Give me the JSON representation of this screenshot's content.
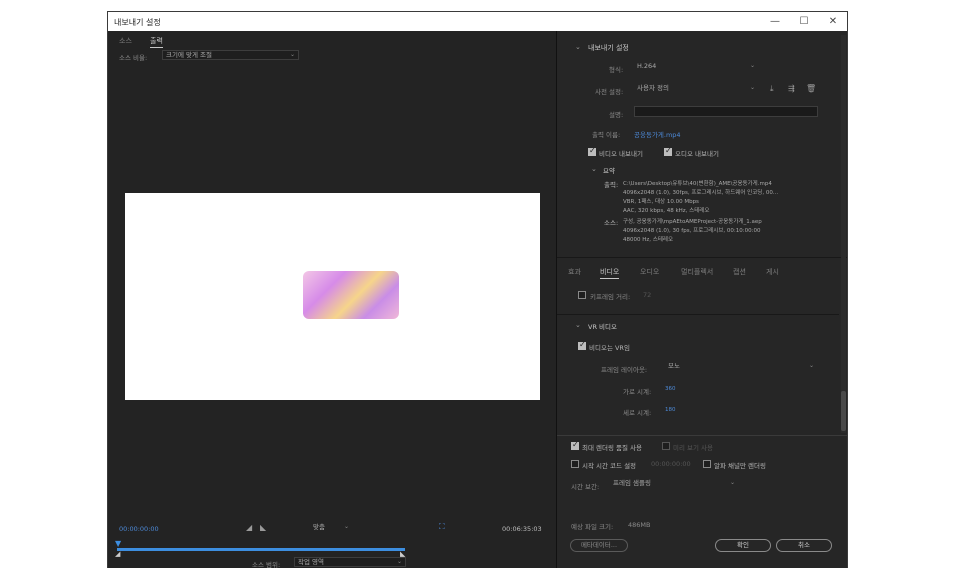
{
  "window": {
    "title": "내보내기 설정",
    "minimize": "—",
    "maximize": "☐",
    "close": "✕"
  },
  "left_panel": {
    "tabs": [
      "소스",
      "출력"
    ],
    "source_scale_label": "소스 비율:",
    "source_scale_value": "크기에 맞게 조절",
    "timecode_start": "00:00:00:00",
    "timecode_end": "00:06:35:03",
    "fit_label": "맞춤",
    "source_range_label": "소스 범위:",
    "source_range_value": "작업 영역"
  },
  "export_settings": {
    "header": "내보내기 설정",
    "format_label": "형식:",
    "format_value": "H.264",
    "preset_label": "사전 설정:",
    "preset_value": "사용자 정의",
    "comments_label": "설명:",
    "comments_value": "",
    "output_name_label": "출력 이름:",
    "output_name_value": "공웅동가게.mp4",
    "export_video_label": "비디오 내보내기",
    "export_audio_label": "오디오 내보내기",
    "summary_header": "요약",
    "output_label": "출력:",
    "output_lines": [
      "C:\\Users\\Desktop\\유튜브\\40(변환함)_AME\\공웅동가게.mp4",
      "4096x2048 (1.0), 30fps, 프로그레시브, 하드웨어 인코딩, 00...",
      "VBR, 1패스, 대상 10.00 Mbps",
      "AAC, 320 kbps, 48 kHz, 스테레오"
    ],
    "source_label": "소스:",
    "source_lines": [
      "구성, 공웅동가게\\mpAEtoAMEProject-공웅동가게_1.aep",
      "4096x2048 (1.0), 30 fps, 프로그레시브, 00:10:00:00",
      "48000 Hz, 스테레오"
    ]
  },
  "settings_tabs": [
    "효과",
    "비디오",
    "오디오",
    "멀티플렉서",
    "캡션",
    "게시"
  ],
  "video": {
    "keyframe_label": "키프레임 거리:",
    "keyframe_value": "72",
    "vr_header": "VR 비디오",
    "vr_checkbox_label": "비디오는 VR임",
    "frame_layout_label": "프레임 레이아웃:",
    "frame_layout_value": "모노",
    "horizontal_fov_label": "가로 시계:",
    "horizontal_fov_value": "360",
    "vertical_fov_label": "세로 시계:",
    "vertical_fov_value": "180"
  },
  "bottom": {
    "max_render_quality_label": "최대 렌더링 품질 사용",
    "use_previews_label": "미리 보기 사용",
    "set_start_timecode_label": "시작 시간 코드 설정",
    "start_timecode_value": "00:00:00:00",
    "render_alpha_label": "알파 채널만 렌더링",
    "time_interpolation_label": "시간 보간:",
    "time_interpolation_value": "프레임 샘플링",
    "estimated_size_label": "예상 파일 크기:",
    "estimated_size_value": "486MB",
    "metadata_button": "메타데이터...",
    "ok_button": "확인",
    "cancel_button": "취소"
  },
  "colors": {
    "accent_blue": "#4d8ad8",
    "panel_dark": "#232323"
  }
}
